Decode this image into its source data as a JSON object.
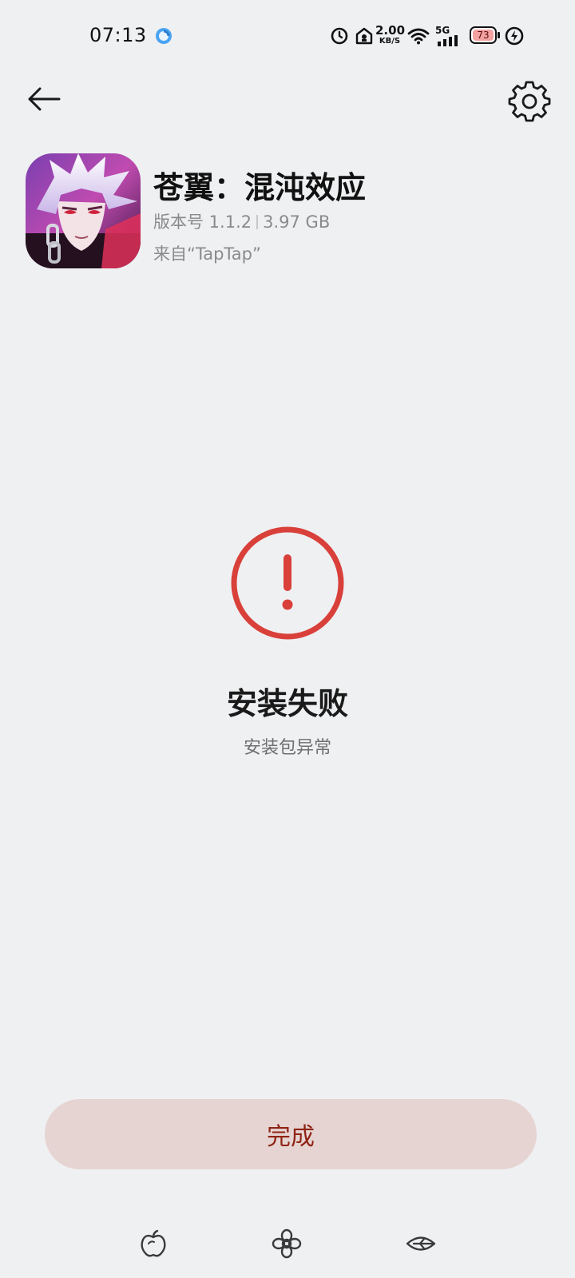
{
  "status_bar": {
    "time": "07:13",
    "net_speed_value": "2.00",
    "net_speed_unit": "KB/S",
    "network_type": "5G",
    "battery_level": "73",
    "icons": [
      "browser-notification-icon",
      "alarm-icon",
      "vpn-icon",
      "wifi-icon",
      "signal-icon",
      "battery-icon",
      "charging-icon"
    ]
  },
  "header": {
    "back_icon": "arrow-left-icon",
    "settings_icon": "gear-icon"
  },
  "app": {
    "name": "苍翼：混沌效应",
    "version": "版本号 1.1.2",
    "size": "3.97 GB",
    "source": "来自“TapTap”"
  },
  "result": {
    "status_icon": "error-icon",
    "title": "安装失败",
    "subtitle": "安装包异常"
  },
  "actions": {
    "done_label": "完成"
  },
  "bottom_nav": {
    "icons": [
      "apple-icon",
      "flower-icon",
      "leaf-eye-icon"
    ]
  },
  "colors": {
    "background": "#eff0f2",
    "error_red": "#d9403a",
    "button_bg": "#e6d4d2",
    "button_text": "#8f2415",
    "battery_badge": "#f3a1a1"
  }
}
